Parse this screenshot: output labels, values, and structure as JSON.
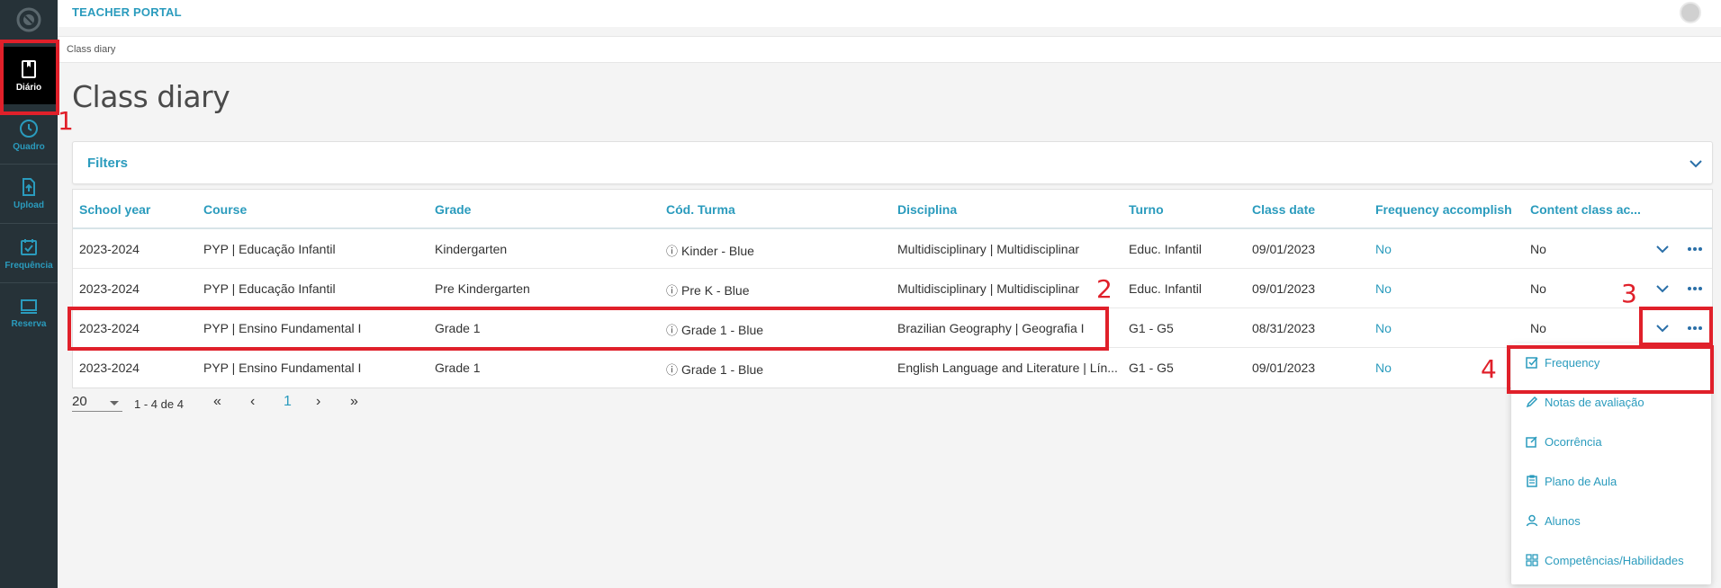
{
  "app": {
    "title": "TEACHER PORTAL"
  },
  "sidebar": {
    "items": [
      {
        "label": "Diário",
        "icon": "book-icon"
      },
      {
        "label": "Quadro",
        "icon": "clock-icon"
      },
      {
        "label": "Upload",
        "icon": "upload-icon"
      },
      {
        "label": "Frequência",
        "icon": "calendar-check-icon"
      },
      {
        "label": "Reserva",
        "icon": "monitor-icon"
      }
    ]
  },
  "breadcrumb": "Class diary",
  "page_title": "Class diary",
  "filters": {
    "label": "Filters"
  },
  "table": {
    "columns": [
      "School year",
      "Course",
      "Grade",
      "Cód. Turma",
      "Disciplina",
      "Turno",
      "Class date",
      "Frequency accomplish",
      "Content class ac..."
    ],
    "rows": [
      {
        "year": "2023-2024",
        "course": "PYP | Educação Infantil",
        "grade": "Kindergarten",
        "turma": "Kinder - Blue",
        "disciplina": "Multidisciplinary | Multidisciplinar",
        "turno": "Educ. Infantil",
        "date": "09/01/2023",
        "freq": "No",
        "content": "No"
      },
      {
        "year": "2023-2024",
        "course": "PYP | Educação Infantil",
        "grade": "Pre Kindergarten",
        "turma": "Pre K - Blue",
        "disciplina": "Multidisciplinary | Multidisciplinar",
        "turno": "Educ. Infantil",
        "date": "09/01/2023",
        "freq": "No",
        "content": "No"
      },
      {
        "year": "2023-2024",
        "course": "PYP | Ensino Fundamental I",
        "grade": "Grade 1",
        "turma": "Grade 1 - Blue",
        "disciplina": "Brazilian Geography | Geografia I",
        "turno": "G1 - G5",
        "date": "08/31/2023",
        "freq": "No",
        "content": "No"
      },
      {
        "year": "2023-2024",
        "course": "PYP | Ensino Fundamental I",
        "grade": "Grade 1",
        "turma": "Grade 1 - Blue",
        "disciplina": "English Language and Literature | Lín...",
        "turno": "G1 - G5",
        "date": "09/01/2023",
        "freq": "No",
        "content": ""
      }
    ]
  },
  "pagination": {
    "page_size": "20",
    "range": "1 - 4 de 4",
    "current_page": "1"
  },
  "row_menu": {
    "items": [
      {
        "label": "Frequency",
        "icon": "checkbox-icon"
      },
      {
        "label": "Notas de avaliação",
        "icon": "pencil-icon"
      },
      {
        "label": "Ocorrência",
        "icon": "edit-note-icon"
      },
      {
        "label": "Plano de Aula",
        "icon": "clipboard-icon"
      },
      {
        "label": "Alunos",
        "icon": "user-icon"
      },
      {
        "label": "Competências/Habilidades",
        "icon": "grid-icon"
      }
    ]
  },
  "annotations": [
    "1",
    "2",
    "3",
    "4"
  ],
  "colors": {
    "accent": "#2a9bbd",
    "sidebar": "#263238",
    "annotation": "#e0202a"
  }
}
